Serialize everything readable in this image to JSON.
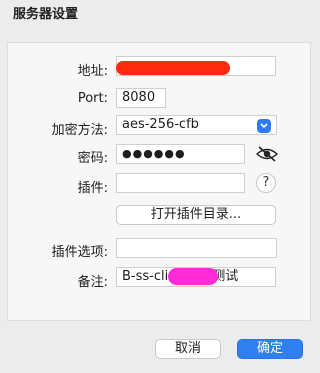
{
  "window": {
    "title": "服务器设置"
  },
  "form": {
    "address": {
      "label": "地址:",
      "value": ""
    },
    "port": {
      "label": "Port:",
      "value": "8080"
    },
    "encryption": {
      "label": "加密方法:",
      "selected": "aes-256-cfb"
    },
    "password": {
      "label": "密码:",
      "masked": "●●●●●●"
    },
    "plugin": {
      "label": "插件:",
      "value": "",
      "help": "?"
    },
    "open_plugin_dir": {
      "label": "打开插件目录..."
    },
    "plugin_options": {
      "label": "插件选项:",
      "value": ""
    },
    "remark": {
      "label": "备注:",
      "value_prefix": "B-ss-cli",
      "value_suffix": "测试"
    }
  },
  "buttons": {
    "cancel": "取消",
    "ok": "确定"
  },
  "colors": {
    "accent": "#2f7ff0",
    "redact_red": "#ff2a10",
    "redact_magenta": "#ff2bd6"
  }
}
